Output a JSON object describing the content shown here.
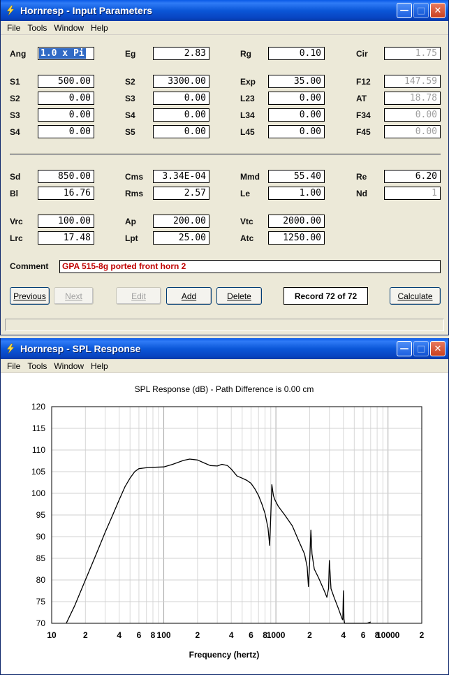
{
  "input_window": {
    "title": "Hornresp - Input Parameters",
    "menu": [
      "File",
      "Tools",
      "Window",
      "Help"
    ],
    "params": {
      "Ang": {
        "label": "Ang",
        "value": "1.0 x Pi"
      },
      "Eg": {
        "label": "Eg",
        "value": "2.83"
      },
      "Rg": {
        "label": "Rg",
        "value": "0.10"
      },
      "Cir": {
        "label": "Cir",
        "value": "1.75"
      },
      "S1": {
        "label": "S1",
        "value": "500.00"
      },
      "S2b": {
        "label": "S2",
        "value": "3300.00"
      },
      "Exp": {
        "label": "Exp",
        "value": "35.00"
      },
      "F12": {
        "label": "F12",
        "value": "147.59"
      },
      "S2": {
        "label": "S2",
        "value": "0.00"
      },
      "S3b": {
        "label": "S3",
        "value": "0.00"
      },
      "L23": {
        "label": "L23",
        "value": "0.00"
      },
      "AT": {
        "label": "AT",
        "value": "18.78"
      },
      "S3": {
        "label": "S3",
        "value": "0.00"
      },
      "S4b": {
        "label": "S4",
        "value": "0.00"
      },
      "L34": {
        "label": "L34",
        "value": "0.00"
      },
      "F34": {
        "label": "F34",
        "value": "0.00"
      },
      "S4": {
        "label": "S4",
        "value": "0.00"
      },
      "S5": {
        "label": "S5",
        "value": "0.00"
      },
      "L45": {
        "label": "L45",
        "value": "0.00"
      },
      "F45": {
        "label": "F45",
        "value": "0.00"
      },
      "Sd": {
        "label": "Sd",
        "value": "850.00"
      },
      "Cms": {
        "label": "Cms",
        "value": "3.34E-04"
      },
      "Mmd": {
        "label": "Mmd",
        "value": "55.40"
      },
      "Re": {
        "label": "Re",
        "value": "6.20"
      },
      "Bl": {
        "label": "Bl",
        "value": "16.76"
      },
      "Rms": {
        "label": "Rms",
        "value": "2.57"
      },
      "Le": {
        "label": "Le",
        "value": "1.00"
      },
      "Nd": {
        "label": "Nd",
        "value": "1"
      },
      "Vrc": {
        "label": "Vrc",
        "value": "100.00"
      },
      "Ap": {
        "label": "Ap",
        "value": "200.00"
      },
      "Vtc": {
        "label": "Vtc",
        "value": "2000.00"
      },
      "Lrc": {
        "label": "Lrc",
        "value": "17.48"
      },
      "Lpt": {
        "label": "Lpt",
        "value": "25.00"
      },
      "Atc": {
        "label": "Atc",
        "value": "1250.00"
      }
    },
    "comment_label": "Comment",
    "comment_value": "GPA 515-8g ported front horn 2",
    "buttons": {
      "previous": "Previous",
      "next": "Next",
      "edit": "Edit",
      "add": "Add",
      "delete": "Delete",
      "calculate": "Calculate"
    },
    "record": "Record 72 of 72"
  },
  "spl_window": {
    "title": "Hornresp - SPL Response",
    "menu": [
      "File",
      "Tools",
      "Window",
      "Help"
    ]
  },
  "colors": {
    "titlebar": "#0b57d8",
    "window_bg": "#ece9d8",
    "comment_text": "#c00000",
    "selection": "#316ac5"
  },
  "chart_data": {
    "type": "line",
    "title": "SPL Response (dB) - Path Difference is 0.00 cm",
    "xlabel": "Frequency (hertz)",
    "ylabel": "",
    "xscale": "log",
    "xlim": [
      10,
      20000
    ],
    "ylim": [
      70,
      120
    ],
    "yticks": [
      70,
      75,
      80,
      85,
      90,
      95,
      100,
      105,
      110,
      115,
      120
    ],
    "xtick_labels": [
      {
        "value": 10,
        "label": "10"
      },
      {
        "value": 20,
        "label": "2"
      },
      {
        "value": 40,
        "label": "4"
      },
      {
        "value": 60,
        "label": "6"
      },
      {
        "value": 80,
        "label": "8"
      },
      {
        "value": 100,
        "label": "100"
      },
      {
        "value": 200,
        "label": "2"
      },
      {
        "value": 400,
        "label": "4"
      },
      {
        "value": 600,
        "label": "6"
      },
      {
        "value": 800,
        "label": "8"
      },
      {
        "value": 1000,
        "label": "1000"
      },
      {
        "value": 2000,
        "label": "2"
      },
      {
        "value": 4000,
        "label": "4"
      },
      {
        "value": 6000,
        "label": "6"
      },
      {
        "value": 8000,
        "label": "8"
      },
      {
        "value": 10000,
        "label": "10000"
      },
      {
        "value": 20000,
        "label": "2"
      }
    ],
    "grid": true,
    "series": [
      {
        "color": "#000000",
        "x": [
          13.5,
          16,
          20,
          25,
          30,
          35,
          40,
          45,
          50,
          55,
          60,
          65,
          70,
          80,
          100,
          120,
          150,
          170,
          200,
          230,
          260,
          300,
          330,
          370,
          400,
          450,
          500,
          550,
          600,
          650,
          700,
          750,
          800,
          850,
          880,
          900,
          920,
          950,
          980,
          1050,
          1200,
          1400,
          1600,
          1800,
          1900,
          1950,
          2000,
          2050,
          2100,
          2200,
          2400,
          2700,
          2850,
          2950,
          3000,
          3100,
          3300,
          3600,
          3900,
          3950,
          4000,
          4050,
          4100,
          4300,
          4600,
          5000,
          5500,
          6500,
          7000
        ],
        "y": [
          70,
          74,
          80,
          86,
          91,
          95,
          98.5,
          101.5,
          103.5,
          105,
          105.7,
          105.8,
          105.9,
          106,
          106.1,
          106.7,
          107.6,
          107.9,
          107.7,
          107,
          106.4,
          106.3,
          106.7,
          106.4,
          105.6,
          104,
          103.5,
          103,
          102.3,
          101,
          99.5,
          97.5,
          95.3,
          92,
          88,
          95,
          102,
          99.5,
          98.5,
          97,
          95,
          92.5,
          89,
          86,
          83,
          78.5,
          84,
          91.5,
          86,
          82.5,
          80.5,
          77.5,
          76,
          78,
          84.5,
          78,
          76,
          73.5,
          71,
          70.8,
          77.5,
          71,
          70,
          70,
          70,
          70,
          70,
          70,
          70.3
        ]
      }
    ]
  }
}
